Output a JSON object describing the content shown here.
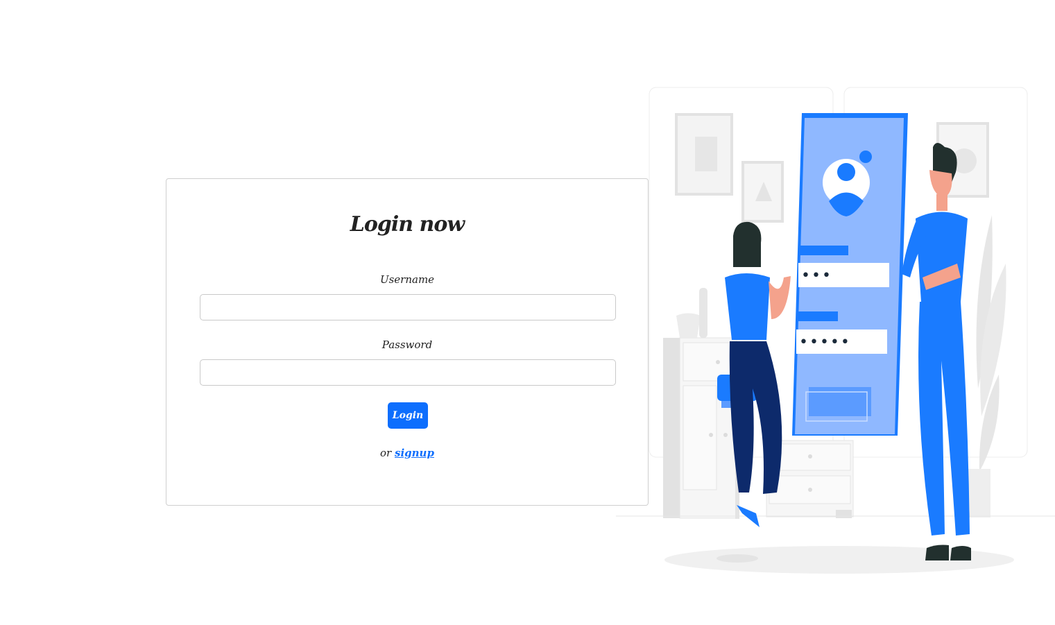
{
  "login": {
    "title": "Login now",
    "username_label": "Username",
    "username_value": "",
    "password_label": "Password",
    "password_value": "",
    "login_button": "Login",
    "or_text": "or",
    "signup_link": "signup"
  },
  "illustration": {
    "phone_username_mask": "•••",
    "phone_password_mask": "•••••"
  },
  "colors": {
    "primary": "#0d6efd",
    "illustration_blue": "#1a7bff",
    "illustration_light_blue": "#8fb8ff",
    "illustration_navy": "#0d2a6b"
  }
}
